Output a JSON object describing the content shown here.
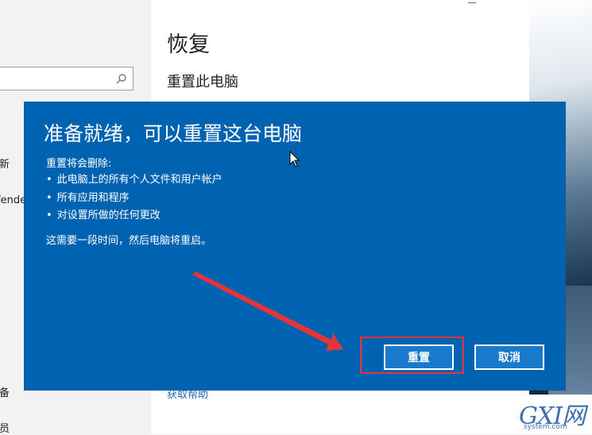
{
  "settings": {
    "heading": "恢复",
    "subheading": "重置此电脑",
    "help_link": "获取帮助",
    "nav_fragments": [
      "新",
      "fende",
      "备",
      "员"
    ]
  },
  "dialog": {
    "title": "准备就绪，可以重置这台电脑",
    "label": "重置将会删除:",
    "items": [
      "此电脑上的所有个人文件和用户帐户",
      "所有应用和程序",
      "对设置所做的任何更改"
    ],
    "note": "这需要一段时间，然后电脑将重启。",
    "reset_button": "重置",
    "cancel_button": "取消"
  },
  "watermark": {
    "logo": "GXI网",
    "url": "system.com"
  },
  "colors": {
    "dialog_bg": "#0063b1",
    "button_bg": "#1979ca",
    "annotation_red": "#e8333a"
  }
}
